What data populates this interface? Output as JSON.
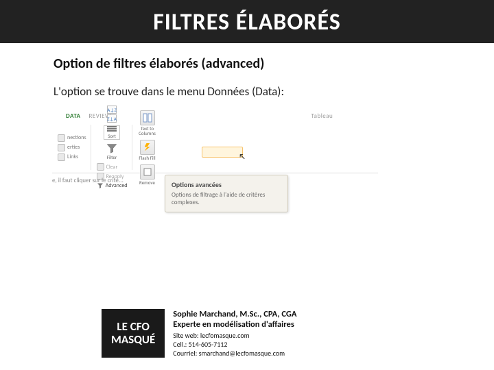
{
  "title": "FILTRES ÉLABORÉS",
  "subtitle": "Option de filtres élaborés (advanced)",
  "body": "L'option se trouve dans le menu Données (Data):",
  "ribbon": {
    "tabs": {
      "data": "DATA",
      "review": "REVIEW",
      "extra": "Tableau"
    },
    "connections": {
      "a": "nections",
      "b": "erties",
      "c": "Links"
    },
    "sort": {
      "az": "A↓Z",
      "za": "Z↓A",
      "sort": "Sort",
      "filter": "Filter"
    },
    "filter_opts": {
      "clear": "Clear",
      "reapply": "Reapply",
      "advanced": "Advanced"
    },
    "tools": {
      "text": "Text to Columns",
      "flash": "Flash Fill",
      "remove": "Remove"
    }
  },
  "tooltip": {
    "title": "Options avancées",
    "body": "Options de filtrage à l'aide de critères complexes."
  },
  "sheet_hint": "e, il faut cliquer sur le crite...",
  "brand": {
    "l1": "LE CFO",
    "l2": "MASQUÉ"
  },
  "author": {
    "name": "Sophie Marchand,",
    "creds": "M.Sc., CPA, CGA",
    "role": "Experte en modélisation d'affaires",
    "site_label": "Site web: ",
    "site": "lecfomasque.com",
    "cell_label": "Cell.: ",
    "cell": "514-605-7112",
    "email_label": "Courriel: ",
    "email": "smarchand@lecfomasque.com"
  }
}
